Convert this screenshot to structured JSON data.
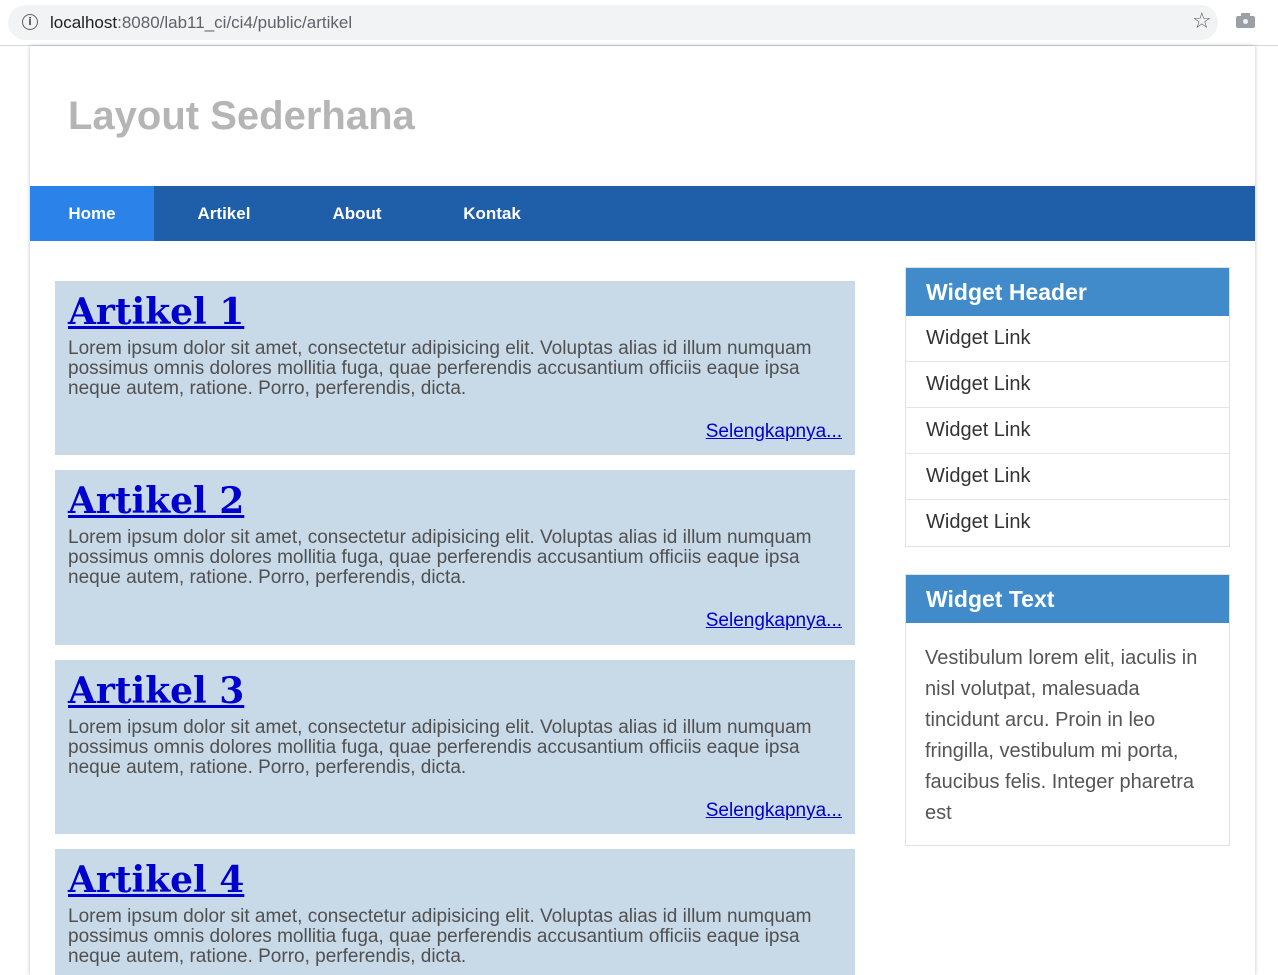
{
  "browser": {
    "url_host": "localhost",
    "url_rest": ":8080/lab11_ci/ci4/public/artikel"
  },
  "site": {
    "title": "Layout Sederhana"
  },
  "nav": {
    "items": [
      {
        "label": "Home",
        "active": true
      },
      {
        "label": "Artikel",
        "active": false
      },
      {
        "label": "About",
        "active": false
      },
      {
        "label": "Kontak",
        "active": false
      }
    ]
  },
  "articles": [
    {
      "title": "Artikel 1",
      "body": "Lorem ipsum dolor sit amet, consectetur adipisicing elit. Voluptas alias id illum numquam possimus omnis dolores mollitia fuga, quae perferendis accusantium officiis eaque ipsa neque autem, ratione. Porro, perferendis, dicta.",
      "read_more": "Selengkapnya..."
    },
    {
      "title": "Artikel 2",
      "body": "Lorem ipsum dolor sit amet, consectetur adipisicing elit. Voluptas alias id illum numquam possimus omnis dolores mollitia fuga, quae perferendis accusantium officiis eaque ipsa neque autem, ratione. Porro, perferendis, dicta.",
      "read_more": "Selengkapnya..."
    },
    {
      "title": "Artikel 3",
      "body": "Lorem ipsum dolor sit amet, consectetur adipisicing elit. Voluptas alias id illum numquam possimus omnis dolores mollitia fuga, quae perferendis accusantium officiis eaque ipsa neque autem, ratione. Porro, perferendis, dicta.",
      "read_more": "Selengkapnya..."
    },
    {
      "title": "Artikel 4",
      "body": "Lorem ipsum dolor sit amet, consectetur adipisicing elit. Voluptas alias id illum numquam possimus omnis dolores mollitia fuga, quae perferendis accusantium officiis eaque ipsa neque autem, ratione. Porro, perferendis, dicta."
    }
  ],
  "sidebar": {
    "widget_links": {
      "header": "Widget Header",
      "links": [
        "Widget Link",
        "Widget Link",
        "Widget Link",
        "Widget Link",
        "Widget Link"
      ]
    },
    "widget_text": {
      "header": "Widget Text",
      "text": "Vestibulum lorem elit, iaculis in nisl volutpat, malesuada tincidunt arcu. Proin in leo fringilla, vestibulum mi porta, faucibus felis. Integer pharetra est"
    }
  },
  "colors": {
    "nav_bg": "#1f5faa",
    "nav_active": "#2b83ea",
    "article_bg": "#c8dae8",
    "widget_header_bg": "#428bca",
    "link": "#0000cc"
  },
  "icons": {
    "info": "info-icon",
    "star": "star-icon",
    "camera": "camera-icon"
  }
}
